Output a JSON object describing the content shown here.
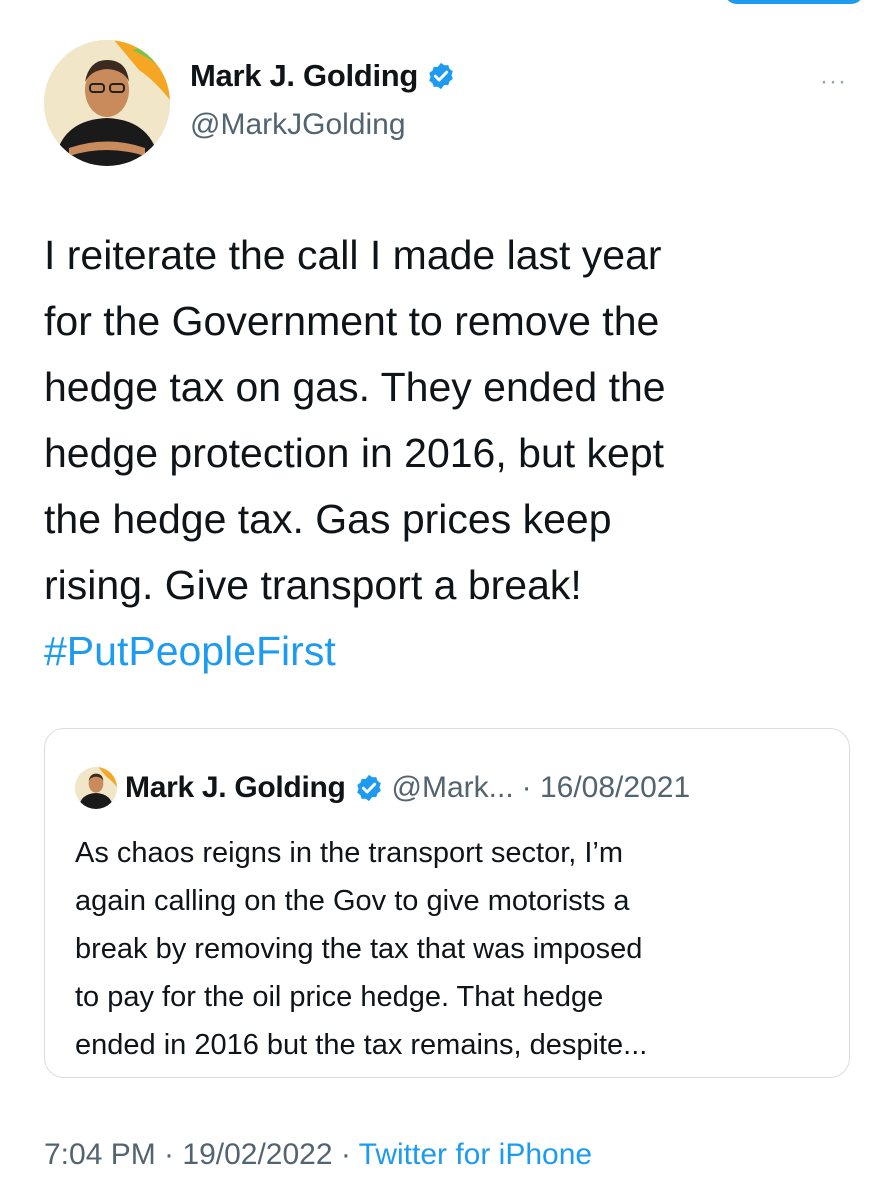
{
  "tweet": {
    "author_name": "Mark J. Golding",
    "author_handle": "@MarkJGolding",
    "more_label": "···",
    "text_lines": [
      "I reiterate the call I made last year",
      "for the Government to remove the",
      "hedge tax on gas. They ended the",
      "hedge protection in 2016, but kept",
      "the hedge tax. Gas prices keep",
      "rising. Give transport a break!"
    ],
    "hashtag": "#PutPeopleFirst",
    "quoted": {
      "author_name": "Mark J. Golding",
      "author_handle": "@Mark...",
      "date": "· 16/08/2021",
      "text_lines": [
        "As chaos reigns in the transport sector, I’m",
        "again calling on the Gov to give motorists a",
        "break by removing the tax that was imposed",
        "to pay for the oil price hedge. That hedge",
        "ended in 2016 but the tax remains, despite..."
      ]
    },
    "timestamp": "7:04 PM · 19/02/2022 ·",
    "source": "Twitter for iPhone"
  },
  "colors": {
    "accent": "#1d9bf0",
    "muted": "#536471",
    "text": "#0f1419"
  },
  "icons": {
    "verified": "verified-badge-icon",
    "more": "more-options-icon"
  }
}
